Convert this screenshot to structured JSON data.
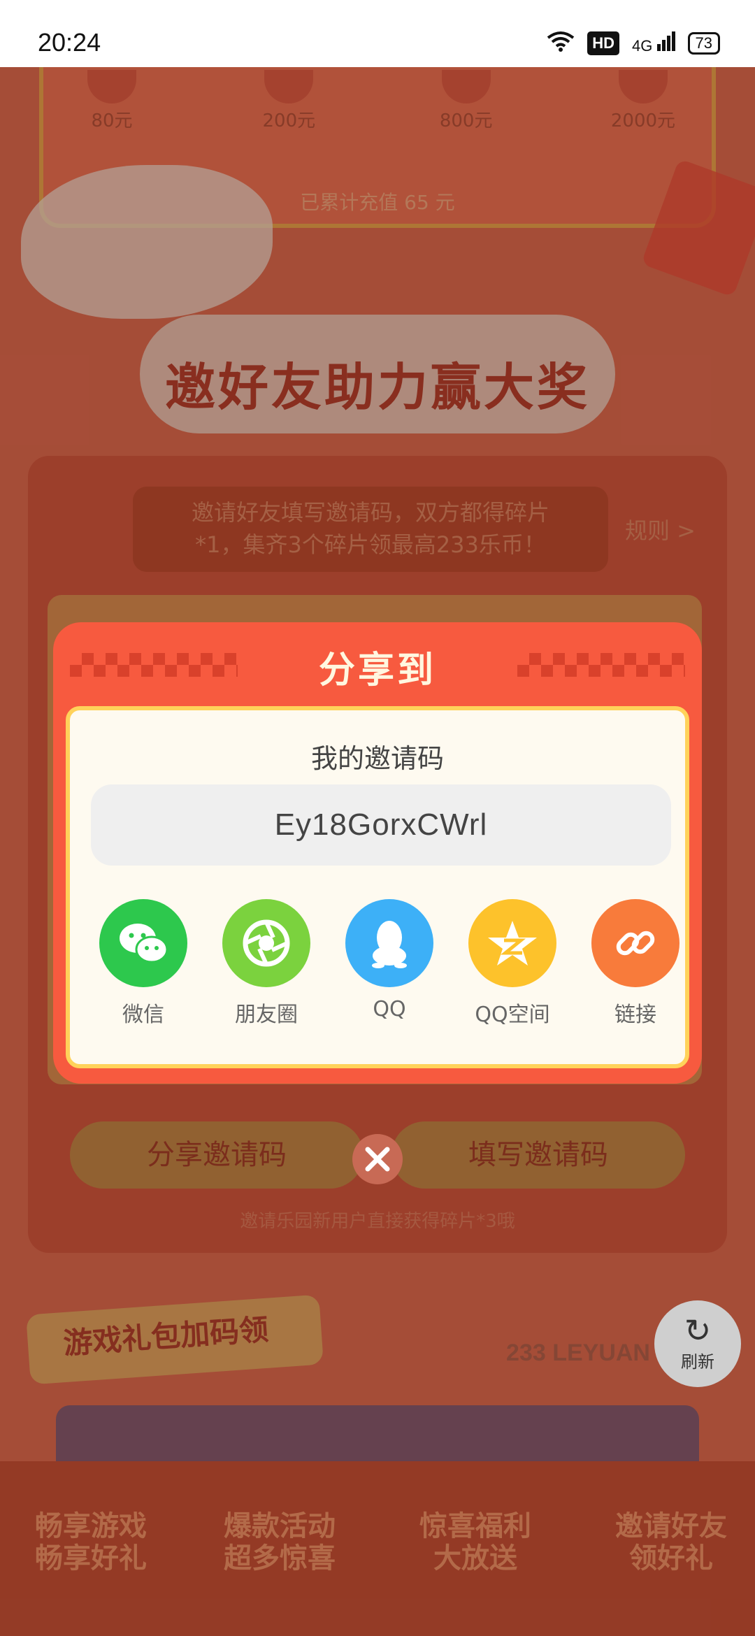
{
  "status_bar": {
    "time": "20:24",
    "network": "4G",
    "hd": "HD",
    "battery": "73"
  },
  "background": {
    "prizes": [
      "80元",
      "200元",
      "800元",
      "2000元"
    ],
    "recharge_text": "已累计充值 65 元",
    "section_title": "邀好友助力赢大奖",
    "notice_line1": "邀请好友填写邀请码，双方都得碎片",
    "notice_line2": "*1，集齐3个碎片领最高233乐币！",
    "rules_link": "规则 >",
    "share_code_button": "分享邀请码",
    "fill_code_button": "填写邀请码",
    "bottom_tip": "邀请乐园新用户直接获得碎片*3哦",
    "gift_tag": "游戏礼包加码领",
    "brand": "233 LEYUAN",
    "refresh_label": "刷新",
    "features": [
      {
        "line1": "畅享游戏",
        "line2": "畅享好礼"
      },
      {
        "line1": "爆款活动",
        "line2": "超多惊喜"
      },
      {
        "line1": "惊喜福利",
        "line2": "大放送"
      },
      {
        "line1": "邀请好友",
        "line2": "领好礼"
      }
    ]
  },
  "dialog": {
    "title": "分享到",
    "code_label": "我的邀请码",
    "invite_code": "Ey18GorxCWrl",
    "share_targets": [
      {
        "label": "微信",
        "icon": "wechat-icon",
        "color": "#2dc84d"
      },
      {
        "label": "朋友圈",
        "icon": "moments-icon",
        "color": "#7bd23e"
      },
      {
        "label": "QQ",
        "icon": "qq-icon",
        "color": "#3db0f7"
      },
      {
        "label": "QQ空间",
        "icon": "qzone-icon",
        "color": "#fdc22b"
      },
      {
        "label": "链接",
        "icon": "link-icon",
        "color": "#f87b3b"
      }
    ]
  },
  "colors": {
    "dialog_red": "#f75a3f",
    "dialog_border": "#ffd25a",
    "page_red": "#b5533d"
  }
}
